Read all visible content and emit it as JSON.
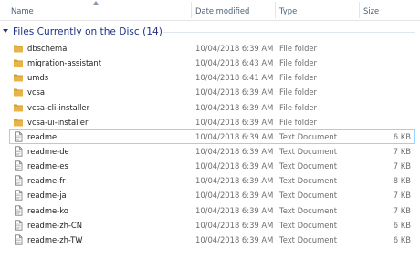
{
  "columns": {
    "name": "Name",
    "date_modified": "Date modified",
    "type": "Type",
    "size": "Size"
  },
  "group": {
    "title": "Files Currently on the Disc (14)"
  },
  "colors": {
    "folder": "#e8b44a",
    "folder_dark": "#d09a2c",
    "selection_border": "#99d1ff",
    "group_title": "#1e3287"
  },
  "files": [
    {
      "name": "dbschema",
      "date": "10/04/2018 6:39 AM",
      "type": "File folder",
      "size": "",
      "icon": "folder-icon"
    },
    {
      "name": "migration-assistant",
      "date": "10/04/2018 6:43 AM",
      "type": "File folder",
      "size": "",
      "icon": "folder-icon"
    },
    {
      "name": "umds",
      "date": "10/04/2018 6:41 AM",
      "type": "File folder",
      "size": "",
      "icon": "folder-icon"
    },
    {
      "name": "vcsa",
      "date": "10/04/2018 6:39 AM",
      "type": "File folder",
      "size": "",
      "icon": "folder-icon"
    },
    {
      "name": "vcsa-cli-installer",
      "date": "10/04/2018 6:39 AM",
      "type": "File folder",
      "size": "",
      "icon": "folder-icon"
    },
    {
      "name": "vcsa-ui-installer",
      "date": "10/04/2018 6:39 AM",
      "type": "File folder",
      "size": "",
      "icon": "folder-icon"
    },
    {
      "name": "readme",
      "date": "10/04/2018 6:39 AM",
      "type": "Text Document",
      "size": "6 KB",
      "icon": "text-document-icon",
      "selected": true
    },
    {
      "name": "readme-de",
      "date": "10/04/2018 6:39 AM",
      "type": "Text Document",
      "size": "7 KB",
      "icon": "text-document-icon"
    },
    {
      "name": "readme-es",
      "date": "10/04/2018 6:39 AM",
      "type": "Text Document",
      "size": "7 KB",
      "icon": "text-document-icon"
    },
    {
      "name": "readme-fr",
      "date": "10/04/2018 6:39 AM",
      "type": "Text Document",
      "size": "8 KB",
      "icon": "text-document-icon"
    },
    {
      "name": "readme-ja",
      "date": "10/04/2018 6:39 AM",
      "type": "Text Document",
      "size": "7 KB",
      "icon": "text-document-icon"
    },
    {
      "name": "readme-ko",
      "date": "10/04/2018 6:39 AM",
      "type": "Text Document",
      "size": "7 KB",
      "icon": "text-document-icon"
    },
    {
      "name": "readme-zh-CN",
      "date": "10/04/2018 6:39 AM",
      "type": "Text Document",
      "size": "6 KB",
      "icon": "text-document-icon"
    },
    {
      "name": "readme-zh-TW",
      "date": "10/04/2018 6:39 AM",
      "type": "Text Document",
      "size": "6 KB",
      "icon": "text-document-icon"
    }
  ]
}
